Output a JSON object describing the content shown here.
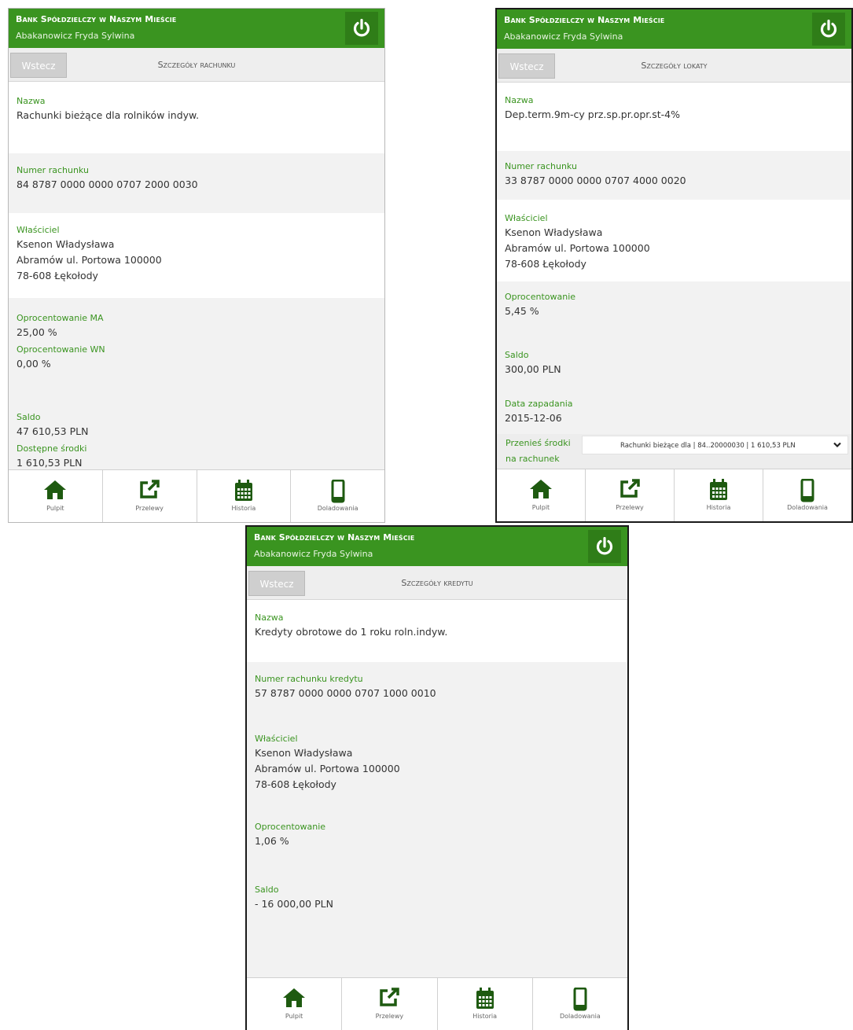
{
  "header": {
    "bank_name": "Bank Spółdzielczy w Naszym Mieście",
    "user_name": "Abakanowicz Fryda Sylwina"
  },
  "back_label": "Wstecz",
  "nav": {
    "items": [
      {
        "label": "Pulpit",
        "icon": "home-icon"
      },
      {
        "label": "Przelewy",
        "icon": "external-link-icon"
      },
      {
        "label": "Historia",
        "icon": "calendar-icon"
      },
      {
        "label": "Doladowania",
        "icon": "mobile-phone-icon"
      }
    ]
  },
  "colors": {
    "brand_green": "#3a9420",
    "power_button": "#2f7d18",
    "label_green": "#3a9420"
  },
  "account_screen": {
    "title": "Szczegóły rachunku",
    "name_label": "Nazwa",
    "name_value": "Rachunki bieżące dla rolników indyw.",
    "number_label": "Numer rachunku",
    "number_value": "84 8787 0000 0000 0707 2000 0030",
    "owner_label": "Właściciel",
    "owner_line1": "Ksenon Władysława",
    "owner_line2": "Abramów ul. Portowa 100000",
    "owner_line3": "78-608 Łękołody",
    "rate_ma_label": "Oprocentowanie MA",
    "rate_ma_value": "25,00 %",
    "rate_wn_label": "Oprocentowanie WN",
    "rate_wn_value": "0,00 %",
    "balance_label": "Saldo",
    "balance_value": "47 610,53 PLN",
    "available_label": "Dostępne środki",
    "available_value": "1 610,53 PLN"
  },
  "deposit_screen": {
    "title": "Szczegóły lokaty",
    "name_label": "Nazwa",
    "name_value": "Dep.term.9m-cy prz.sp.pr.opr.st-4%",
    "number_label": "Numer rachunku",
    "number_value": "33 8787 0000 0000 0707 4000 0020",
    "owner_label": "Właściciel",
    "owner_line1": "Ksenon Władysława",
    "owner_line2": "Abramów ul. Portowa 100000",
    "owner_line3": "78-608 Łękołody",
    "rate_label": "Oprocentowanie",
    "rate_value": "5,45 %",
    "balance_label": "Saldo",
    "balance_value": "300,00 PLN",
    "maturity_label": "Data zapadania",
    "maturity_value": "2015-12-06",
    "transfer_label_line1": "Przenieś środki",
    "transfer_label_line2": "na rachunek",
    "transfer_selected": "Rachunki bieżące dla | 84..20000030 | 1 610,53 PLN"
  },
  "credit_screen": {
    "title": "Szczegóły kredytu",
    "name_label": "Nazwa",
    "name_value": "Kredyty obrotowe do 1 roku roln.indyw.",
    "number_label": "Numer rachunku kredytu",
    "number_value": "57 8787 0000 0000 0707 1000 0010",
    "owner_label": "Właściciel",
    "owner_line1": "Ksenon Władysława",
    "owner_line2": "Abramów ul. Portowa 100000",
    "owner_line3": "78-608 Łękołody",
    "rate_label": "Oprocentowanie",
    "rate_value": "1,06 %",
    "balance_label": "Saldo",
    "balance_value": "- 16 000,00 PLN"
  }
}
